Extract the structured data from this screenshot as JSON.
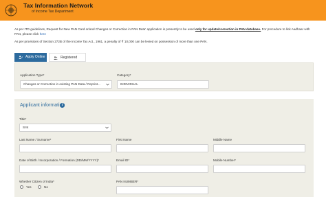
{
  "header": {
    "title": "Tax Information Network",
    "subtitle": "of Income Tax Department"
  },
  "notices": {
    "n1_pre": "As per ITD guidelines, Request for New PAN Card or/and Changes or Correction in PAN Data' application is presently to be used ",
    "n1_bold": "only for update/correction in PAN database.",
    "n1_post": " For procedure to link Aadhaar with PAN, please click ",
    "n1_link": "here",
    "n2": "As per provisions of Section 272B of the Income Tax Act., 1961, a penalty of ₹ 10,000 can be levied on possession of more than one PAN."
  },
  "tabs": [
    {
      "label": "Apply Online",
      "active": true
    },
    {
      "label": "Registered User",
      "active": false
    }
  ],
  "application": {
    "type_label": "Application Type*",
    "type_value": "Changes or Correction in existing PAN Data / Reprint...",
    "category_label": "Category*",
    "category_value": "INDIVIDUAL"
  },
  "applicant": {
    "section_title": "Applicant information",
    "title_label": "Title*",
    "title_value": "Smt",
    "last_name_label": "Last Name / Surname*",
    "first_name_label": "First Name",
    "middle_name_label": "Middle Name",
    "dob_label": "Date of Birth / Incorporation / Formation (DD/MM/YYYY)*",
    "email_label": "Email ID*",
    "mobile_label": "Mobile Number*",
    "citizen_label": "Whether Citizen of India*",
    "yes_label": "Yes",
    "no_label": "No",
    "pan_label": "PAN NUMBER*"
  },
  "colors": {
    "header_bg": "#f7941d",
    "tab_active": "#2d6b9e",
    "panel_bg": "#efeee6",
    "link": "#1e61b0"
  },
  "icons": {
    "logo": "department-emblem-icon",
    "apply_tab": "user-edit-icon",
    "registered_tab": "user-group-icon",
    "info": "info-icon"
  }
}
